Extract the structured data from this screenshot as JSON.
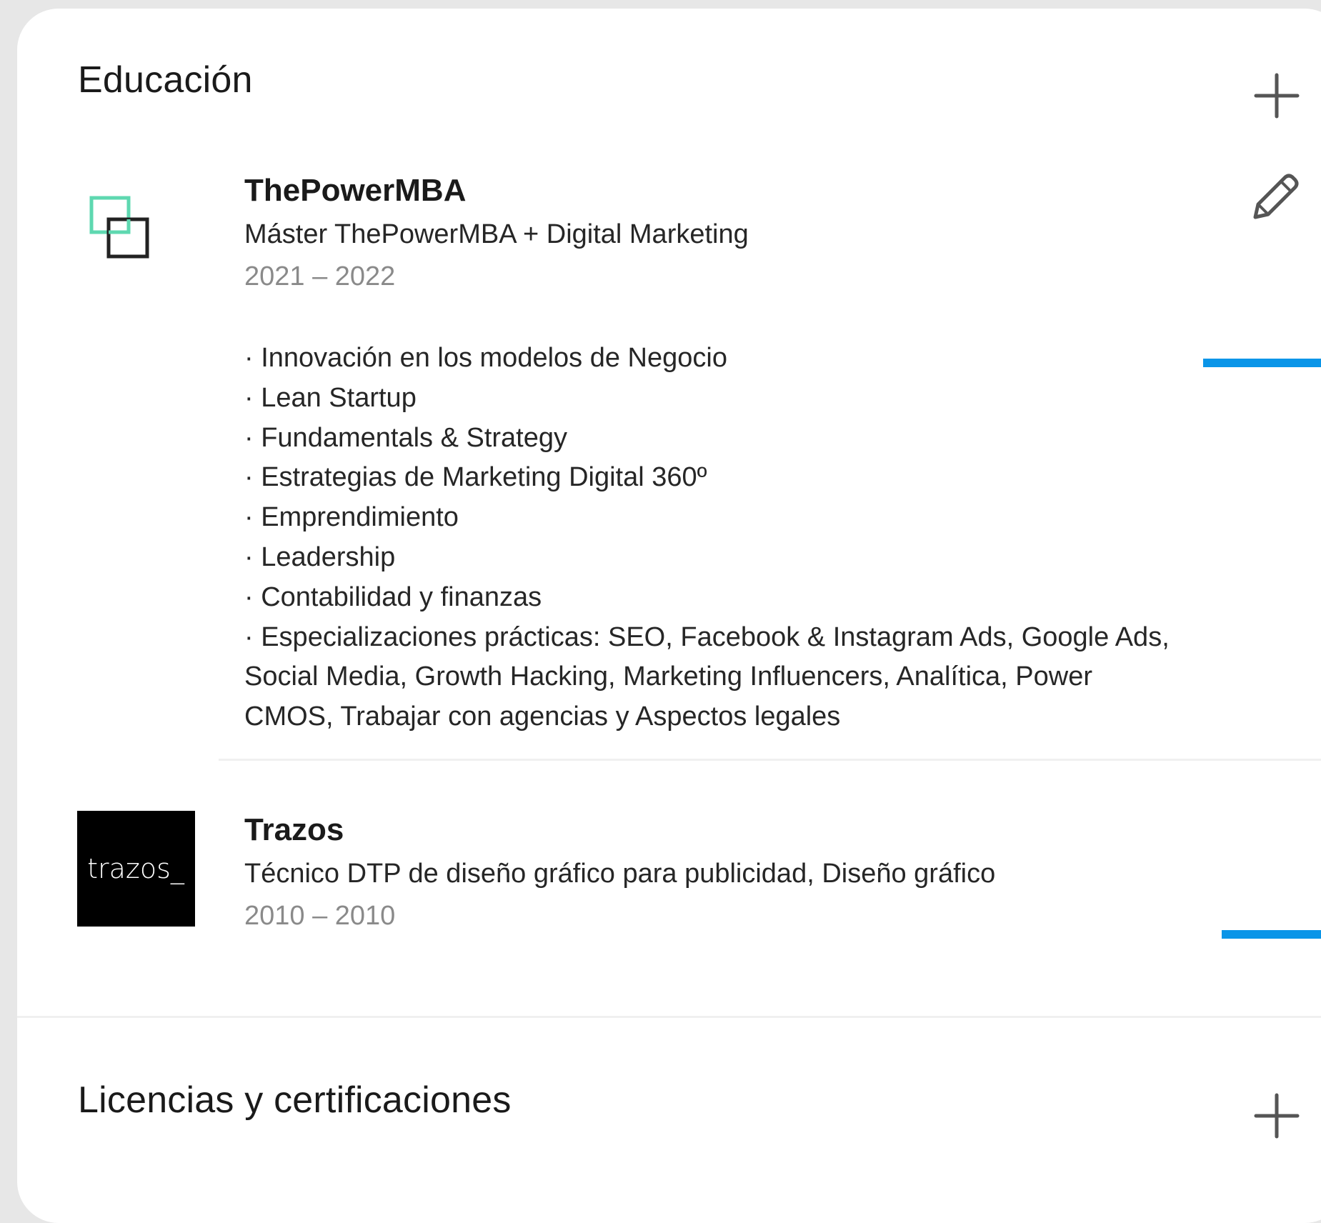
{
  "education": {
    "title": "Educación",
    "add_icon": "plus-icon",
    "edit_icon": "pencil-icon",
    "entries": [
      {
        "school": "ThePowerMBA",
        "logo": "thepowermba-logo",
        "logo_colors": {
          "green": "#5ed8b0",
          "dark": "#222222"
        },
        "degree": "Máster ThePowerMBA + Digital Marketing",
        "dates": "2021 – 2022",
        "description": [
          "· Innovación en los modelos de Negocio",
          "· Lean Startup",
          "· Fundamentals & Strategy",
          "· Estrategias de Marketing Digital 360º",
          "· Emprendimiento",
          "· Leadership",
          "· Contabilidad y finanzas",
          "· Especializaciones prácticas: SEO, Facebook & Instagram Ads, Google Ads, Social Media, Growth Hacking, Marketing Influencers, Analítica, Power CMOS, Trabajar con agencias y Aspectos legales"
        ]
      },
      {
        "school": "Trazos",
        "logo": "trazos-logo",
        "logo_text": "trazos_",
        "degree": "Técnico DTP de diseño gráfico para publicidad, Diseño gráfico",
        "dates": "2010 – 2010"
      }
    ]
  },
  "certifications": {
    "title": "Licencias y certificaciones",
    "add_icon": "plus-icon"
  },
  "colors": {
    "background": "#e7e7e7",
    "card": "#ffffff",
    "accent_blue": "#0a95e8",
    "text_primary": "#1a1a1a",
    "text_secondary": "#8a8a8a"
  }
}
